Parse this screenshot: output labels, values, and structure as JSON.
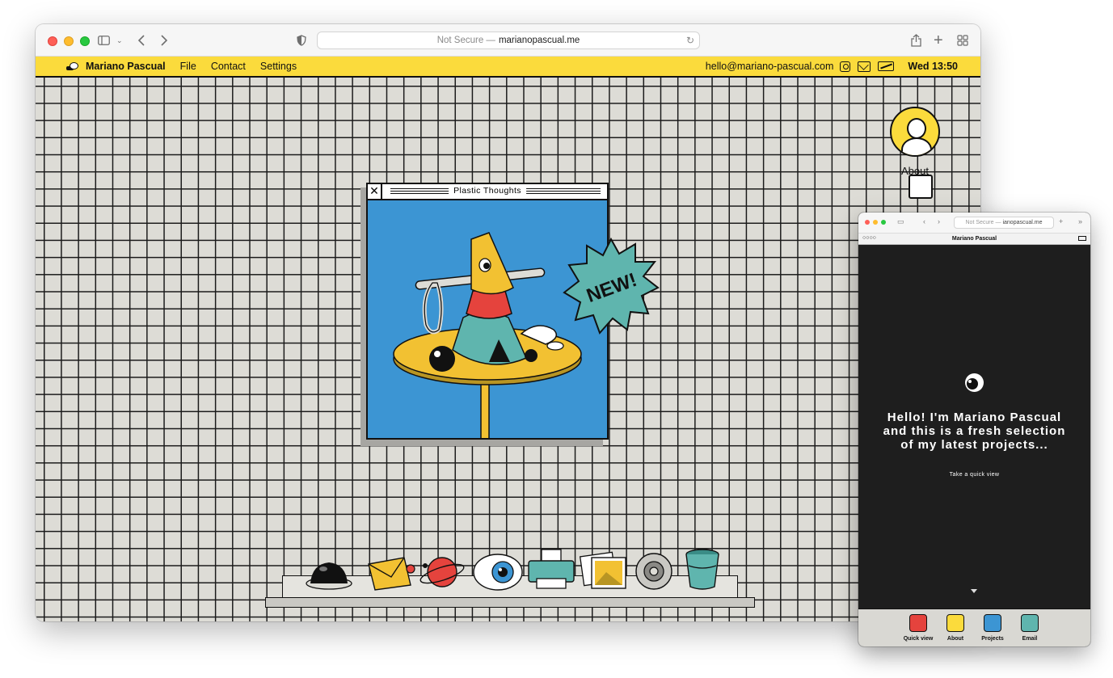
{
  "main_window": {
    "address_prefix": "Not Secure —",
    "address_host": "marianopascual.me",
    "menubar": {
      "brand": "Mariano Pascual",
      "items": [
        "File",
        "Contact",
        "Settings"
      ],
      "email": "hello@mariano-pascual.com",
      "clock": "Wed 13:50"
    },
    "desktop": {
      "feature_window_title": "Plastic Thoughts",
      "badge_text": "NEW!",
      "about_label": "About"
    },
    "dock_icons": [
      "helmet-icon",
      "envelope-icon",
      "planet-icon",
      "eye-icon",
      "printer-icon",
      "photos-icon",
      "gear-icon",
      "bucket-icon"
    ]
  },
  "mobile_window": {
    "address_prefix": "Not Secure —",
    "address_host": "ianopascual.me",
    "title": "Mariano Pascual",
    "hero_text": "Hello! I'm Mariano Pascual and this is a fresh selection of my latest projects...",
    "hero_link": "Take a quick view",
    "dock": [
      {
        "label": "Quick view",
        "color": "#e5433d"
      },
      {
        "label": "About",
        "color": "#fbdb3c"
      },
      {
        "label": "Projects",
        "color": "#3c95d3"
      },
      {
        "label": "Email",
        "color": "#5fb5ae"
      }
    ]
  },
  "colors": {
    "accent_yellow": "#fbdb3c",
    "canvas_blue": "#3c95d3",
    "badge_teal": "#5fb5ae",
    "desktop_grey": "#dddcd6"
  }
}
